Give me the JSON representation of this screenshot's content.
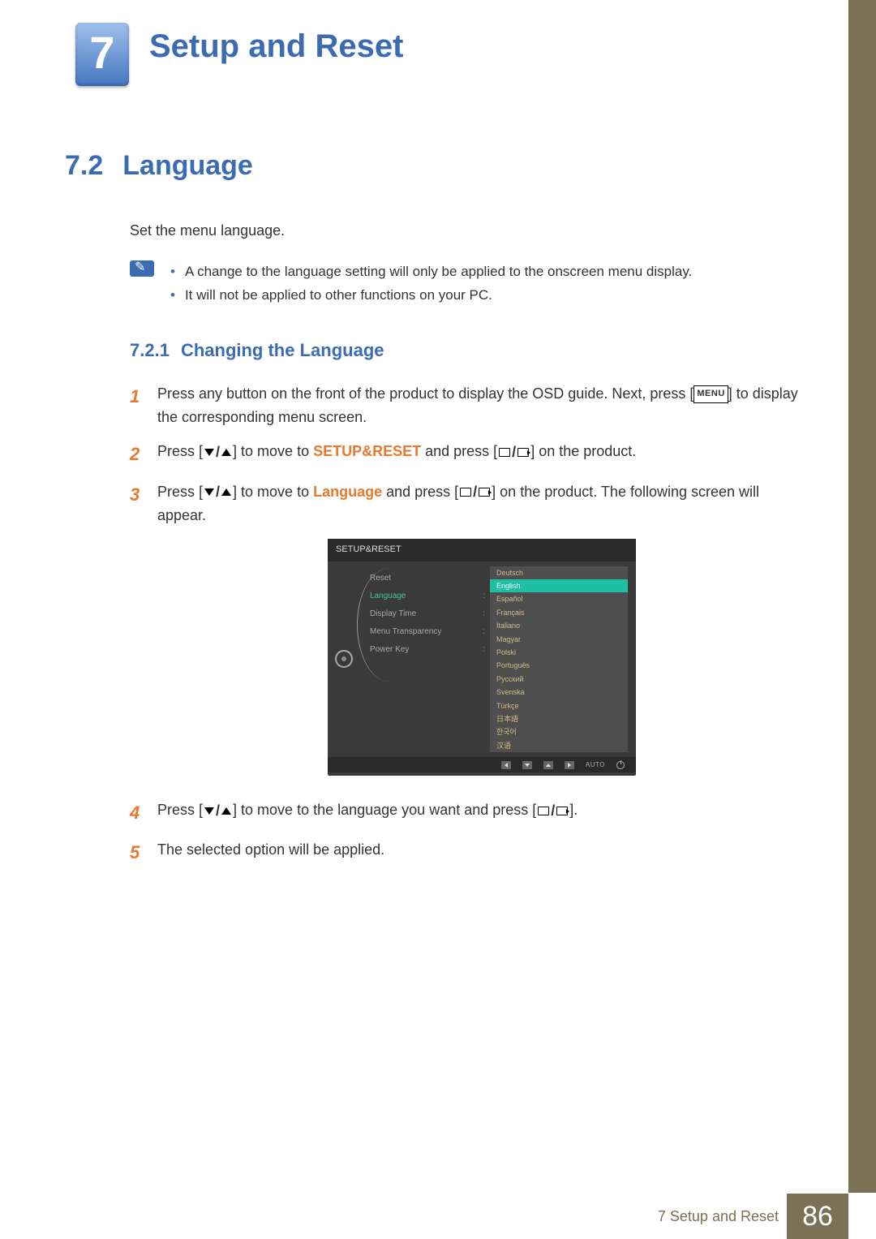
{
  "chapter": {
    "number": "7",
    "title": "Setup and Reset"
  },
  "section": {
    "number": "7.2",
    "title": "Language"
  },
  "intro": "Set the menu language.",
  "notes": [
    "A change to the language setting will only be applied to the onscreen menu display.",
    "It will not be applied to other functions on your PC."
  ],
  "subsection": {
    "number": "7.2.1",
    "title": "Changing the Language"
  },
  "steps": {
    "s1a": "Press any button on the front of the product to display the OSD guide. Next, press [",
    "s1b": "] to display the corresponding menu screen.",
    "s2a": "Press [",
    "s2b": "] to move to ",
    "s2c": "SETUP&RESET",
    "s2d": " and press [",
    "s2e": "] on the product.",
    "s3a": "Press [",
    "s3b": "] to move to ",
    "s3c": "Language",
    "s3d": " and press [",
    "s3e": "] on the product. The following screen will appear.",
    "s4a": "Press [",
    "s4b": "] to move to the language you want and press [",
    "s4c": "].",
    "s5": "The selected option will be applied."
  },
  "step_numbers": [
    "1",
    "2",
    "3",
    "4",
    "5"
  ],
  "menu_label": "MENU",
  "osd": {
    "title": "SETUP&RESET",
    "items": [
      "Reset",
      "Language",
      "Display Time",
      "Menu Transparency",
      "Power Key"
    ],
    "selectedIndex": 1,
    "languages": [
      "Deutsch",
      "English",
      "Español",
      "Français",
      "Italiano",
      "Magyar",
      "Polski",
      "Português",
      "Русский",
      "Svenska",
      "Türkçe",
      "日本語",
      "한국어",
      "汉语"
    ],
    "langSelectedIndex": 1,
    "footer_auto": "AUTO"
  },
  "footer": {
    "text": "7 Setup and Reset",
    "page": "86"
  }
}
